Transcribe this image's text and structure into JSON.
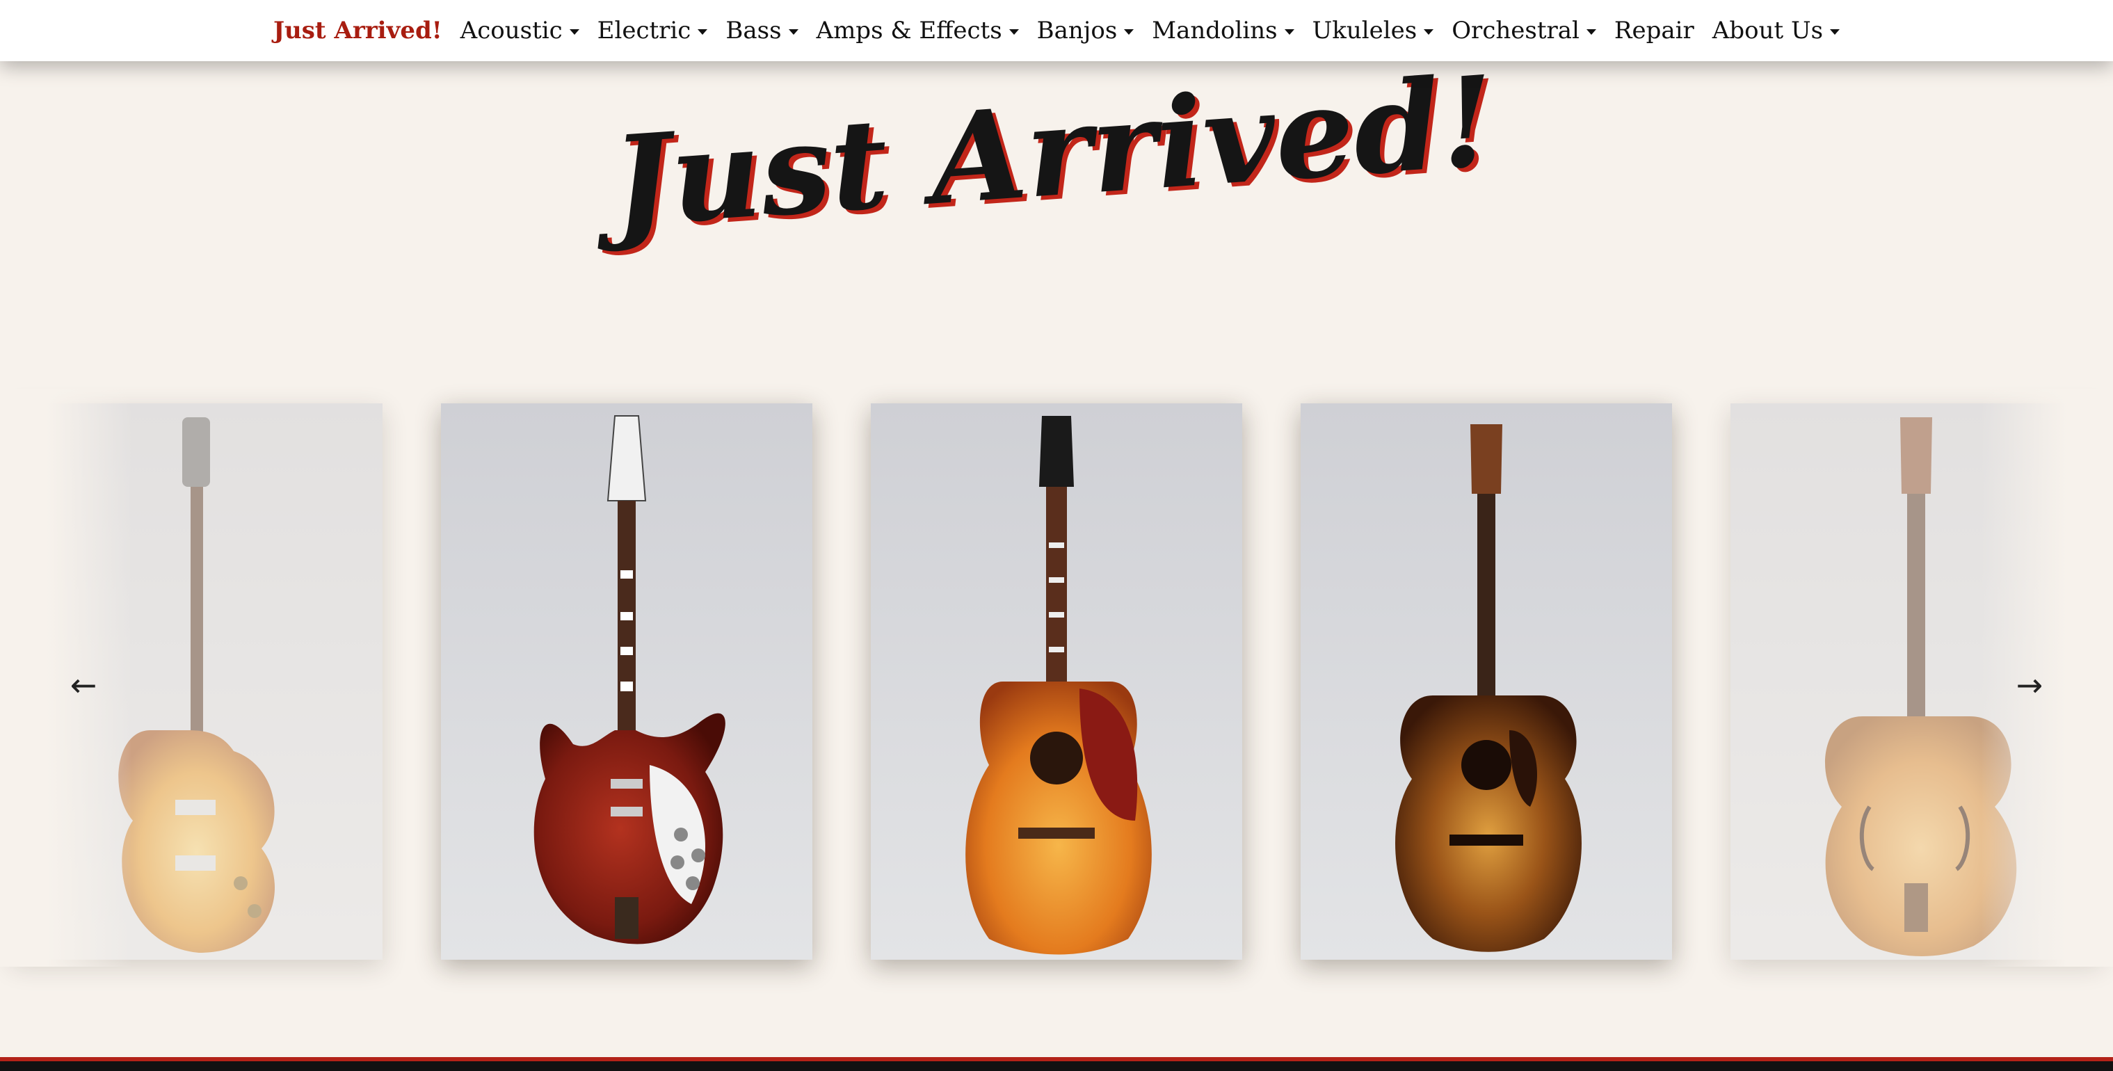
{
  "nav": {
    "items": [
      {
        "label": "Just Arrived!",
        "dropdown": false,
        "featured": true
      },
      {
        "label": "Acoustic",
        "dropdown": true
      },
      {
        "label": "Electric",
        "dropdown": true
      },
      {
        "label": "Bass",
        "dropdown": true
      },
      {
        "label": "Amps & Effects",
        "dropdown": true
      },
      {
        "label": "Banjos",
        "dropdown": true
      },
      {
        "label": "Mandolins",
        "dropdown": true
      },
      {
        "label": "Ukuleles",
        "dropdown": true
      },
      {
        "label": "Orchestral",
        "dropdown": true
      },
      {
        "label": "Repair",
        "dropdown": false
      },
      {
        "label": "About Us",
        "dropdown": true
      }
    ]
  },
  "hero": {
    "title": "Just Arrived!"
  },
  "carousel": {
    "prev_label": "←",
    "next_label": "→",
    "items": [
      {
        "kind": "les-paul",
        "faded": true
      },
      {
        "kind": "rickenbacker-12",
        "faded": false
      },
      {
        "kind": "hummingbird",
        "faded": false
      },
      {
        "kind": "martin-flattop",
        "faded": false
      },
      {
        "kind": "archtop",
        "faded": true
      }
    ]
  },
  "colors": {
    "accent": "#a81d10",
    "background": "#f7f2ec",
    "footer": "#111111",
    "footer_stripe": "#b32218"
  }
}
